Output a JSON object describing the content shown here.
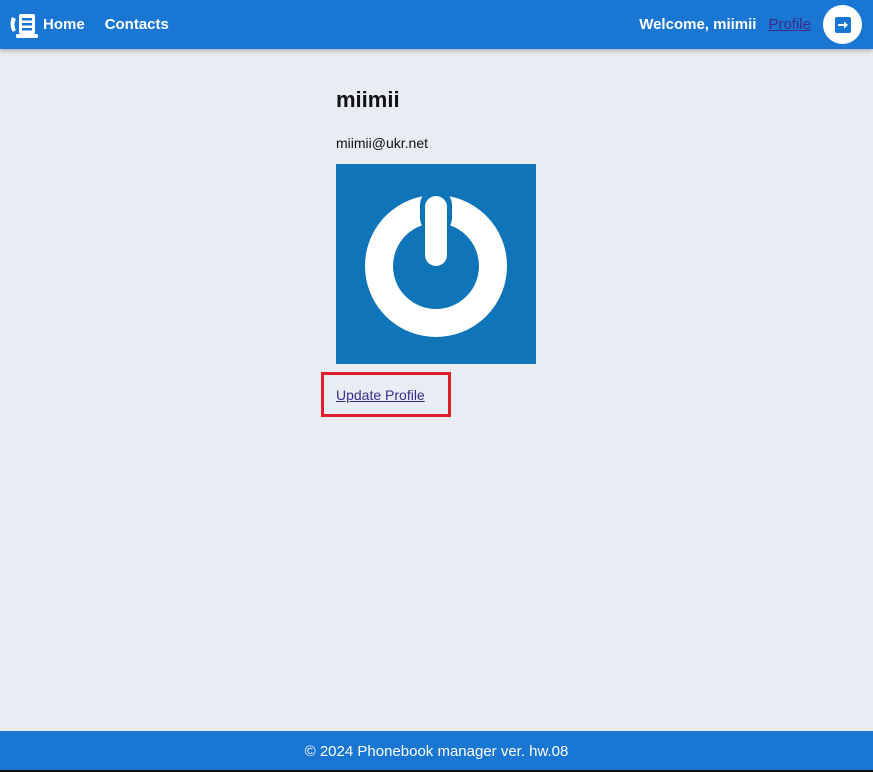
{
  "header": {
    "logo_icon": "phonebook-logo-icon",
    "nav": {
      "home_label": "Home",
      "contacts_label": "Contacts"
    },
    "welcome_text": "Welcome, miimii",
    "profile_link_label": "Profile",
    "logout_icon": "logout-arrow-icon"
  },
  "profile": {
    "name": "miimii",
    "email": "miimii@ukr.net",
    "avatar_icon": "power-symbol-avatar",
    "update_link_label": "Update Profile"
  },
  "footer": {
    "text": "© 2024 Phonebook manager ver. hw.08"
  },
  "colors": {
    "brand": "#1976d2",
    "page_background": "#e8ecf3",
    "avatar_background": "#0f75b8",
    "highlight_border": "#e01e2b",
    "link": "#3a2a8c"
  }
}
